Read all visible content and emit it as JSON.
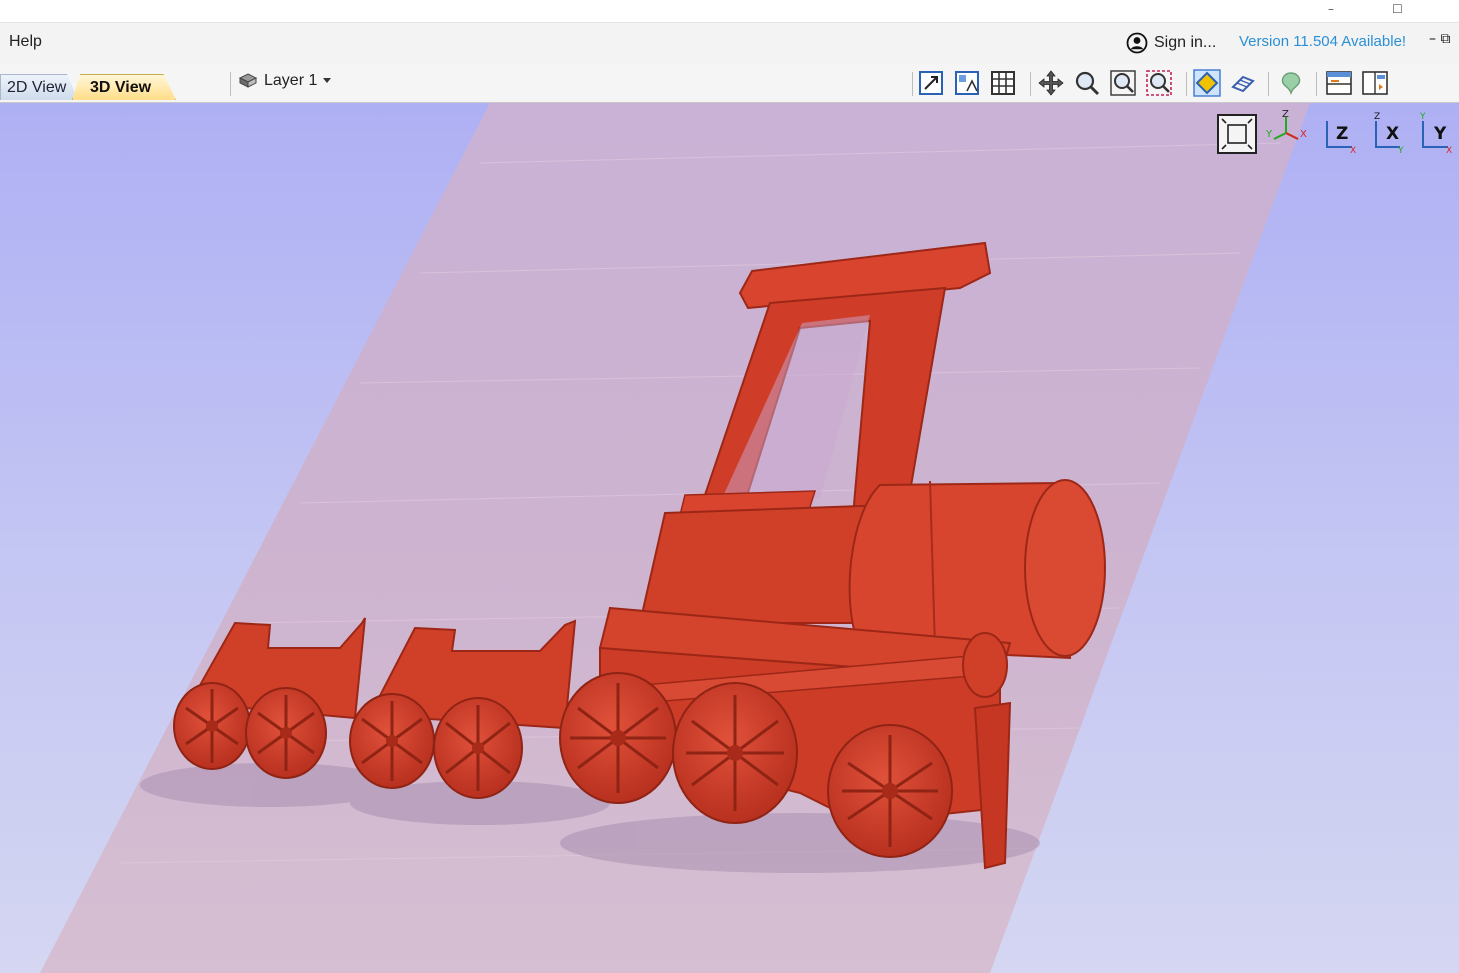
{
  "window": {
    "minimize_glyph": "–",
    "maximize_glyph": "☐",
    "restore_glyph": "⧉"
  },
  "menu": {
    "help_label": "Help"
  },
  "account": {
    "sign_in_label": "Sign in...",
    "version_notice": "Version 11.504 Available!"
  },
  "tabs": [
    {
      "label": "2D View",
      "active": false
    },
    {
      "label": "3D View",
      "active": true
    }
  ],
  "layer": {
    "label": "Layer 1"
  },
  "toolbar_icons": [
    "fit-view-icon",
    "drawing-overlay-icon",
    "grid-icon",
    "pan-icon",
    "zoom-in-icon",
    "zoom-extents-icon",
    "zoom-box-icon",
    "shaded-view-icon",
    "wireframe-view-icon",
    "toolpath-preview-icon",
    "split-view-icon",
    "panel-toggle-icon"
  ],
  "view_orientation": {
    "buttons": [
      {
        "name": "zoom-extents-3d",
        "label": ""
      },
      {
        "name": "iso-view",
        "axes": [
          "Z",
          "Y",
          "X"
        ]
      },
      {
        "name": "front-view",
        "axes": [
          "Z",
          "X"
        ]
      },
      {
        "name": "side-view",
        "axes": [
          "Z",
          "X",
          "Y"
        ]
      },
      {
        "name": "top-view",
        "axes": [
          "Y",
          "Y",
          "X"
        ]
      }
    ]
  },
  "scene": {
    "model": "train-relief",
    "material_color": "#d8442e",
    "background_top": "#aeb0f4",
    "background_bottom": "#d4d6f2"
  },
  "colors": {
    "accent": "#2b8fd6",
    "tab_active": "#ffdd88",
    "tab_inactive": "#cfdcec"
  }
}
